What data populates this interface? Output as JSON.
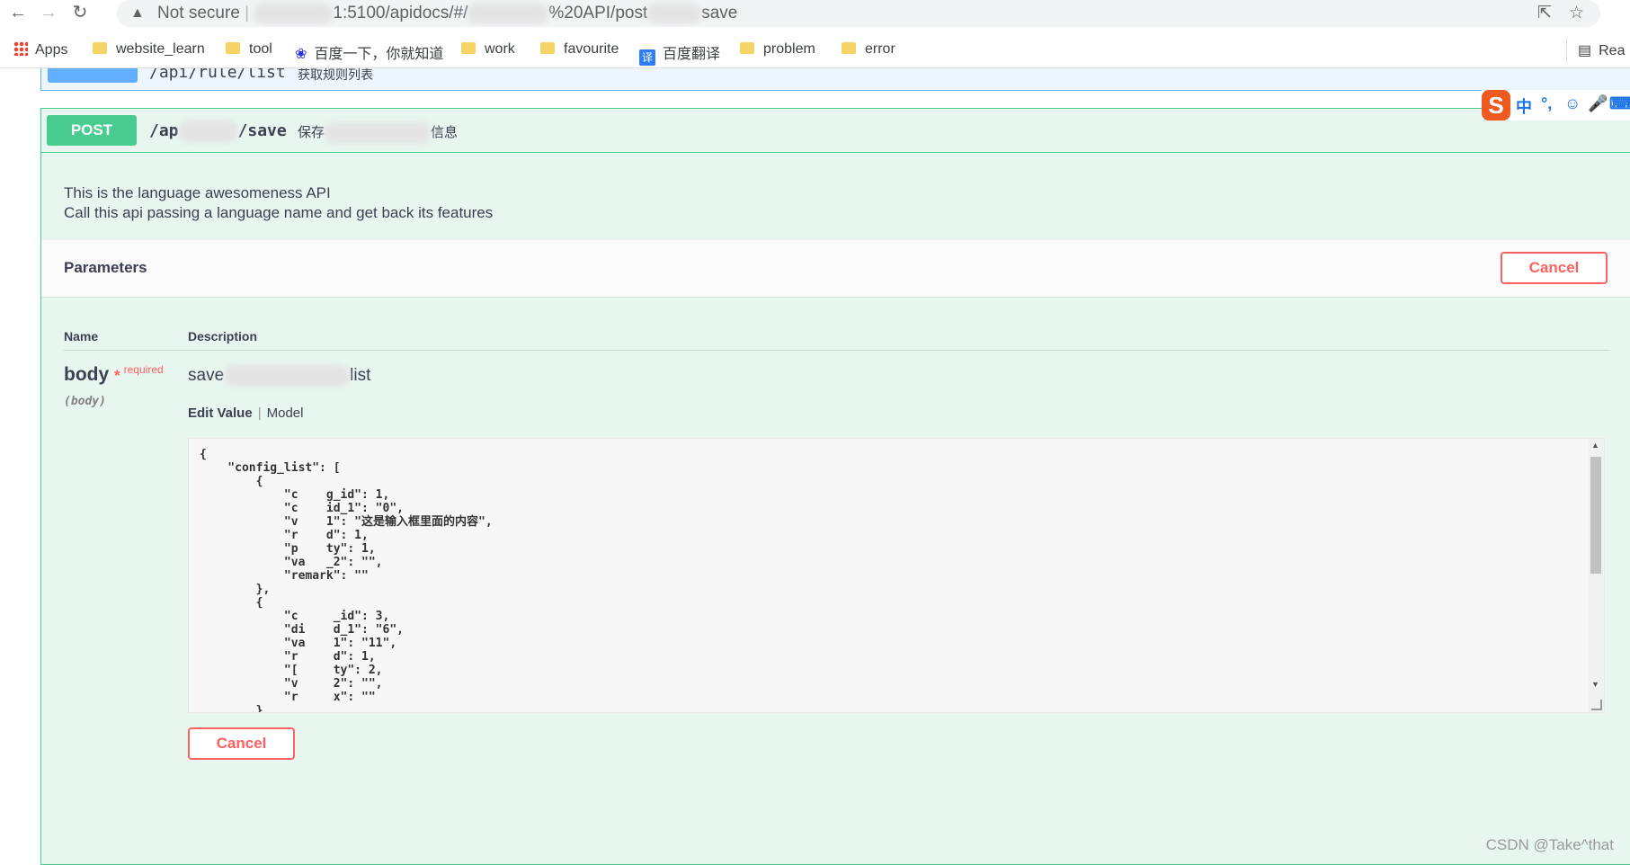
{
  "browser": {
    "security": "Not secure",
    "url_prefix": "1:5100/apidocs/#/",
    "url_middle": "%20API/post",
    "url_suffix": "save",
    "bookmarks": [
      {
        "label": "Apps",
        "icon": "apps-grid-icon"
      },
      {
        "label": "website_learn",
        "icon": "folder-icon"
      },
      {
        "label": "tool",
        "icon": "folder-icon"
      },
      {
        "label": "百度一下，你就知道",
        "icon": "baidu-icon"
      },
      {
        "label": "work",
        "icon": "folder-icon"
      },
      {
        "label": "favourite",
        "icon": "folder-icon"
      },
      {
        "label": "百度翻译",
        "icon": "translate-icon"
      },
      {
        "label": "problem",
        "icon": "folder-icon"
      },
      {
        "label": "error",
        "icon": "folder-icon"
      }
    ],
    "reading_list": "Rea"
  },
  "prev_endpoint": {
    "path": "/api/rule/list",
    "summary": "获取规则列表"
  },
  "operation": {
    "method": "POST",
    "path_start": "/ap",
    "path_end": "/save",
    "summary_start": "保存",
    "summary_end": "信息",
    "description_line1": "This is the language awesomeness API",
    "description_line2": "Call this api passing a language name and get back its features"
  },
  "parameters": {
    "title": "Parameters",
    "cancel_label": "Cancel",
    "col_name": "Name",
    "col_description": "Description",
    "param_name": "body",
    "required_star": "*",
    "required_label": "required",
    "param_in": "(body)",
    "param_desc_start": "save",
    "param_desc_end": "list",
    "tab_edit": "Edit Value",
    "tab_model": "Model",
    "body_value": "{\n    \"config_list\": [\n        {\n            \"c    g_id\": 1,\n            \"c    id_1\": \"0\",\n            \"v    1\": \"这是输入框里面的内容\",\n            \"r    d\": 1,\n            \"p    ty\": 1,\n            \"va   _2\": \"\",\n            \"remark\": \"\"\n        },\n        {\n            \"c     _id\": 3,\n            \"di    d_1\": \"6\",\n            \"va    1\": \"11\",\n            \"r     d\": 1,\n            \"[     ty\": 2,\n            \"v     2\": \"\",\n            \"r     x\": \"\"\n        }",
    "cancel_bottom_label": "Cancel"
  },
  "ime": {
    "logo": "S",
    "lang": "中"
  },
  "watermark": "CSDN @Take^that"
}
